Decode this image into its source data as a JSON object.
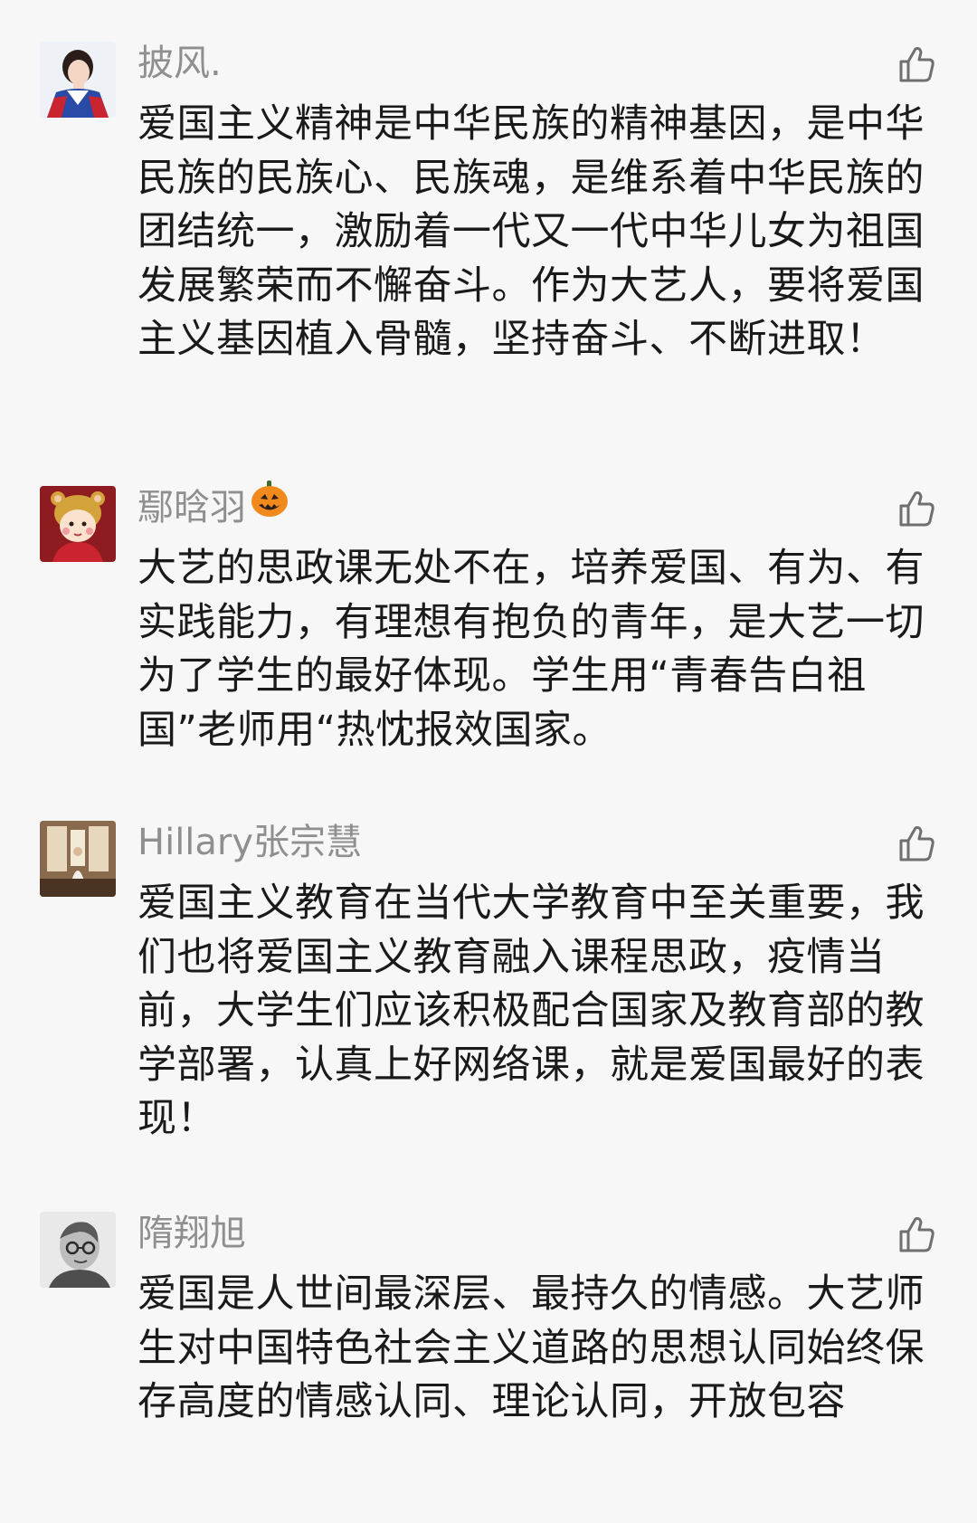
{
  "comments": [
    {
      "username": "披风.",
      "username_emoji": "",
      "avatar": "avatar-cartoon-man",
      "text": "爱国主义精神是中华民族的精神基因，是中华民族的民族心、民族魂，是维系着中华民族的团结统一，激励着一代又一代中华儿女为祖国发展繁荣而不懈奋斗。作为大艺人，要将爱国主义基因植入骨髓，坚持奋斗、不断进取！",
      "like_icon": "thumbs-up-icon"
    },
    {
      "username": "鄢晗羽",
      "username_emoji": "jack-o-lantern-icon",
      "avatar": "avatar-cartoon-girl",
      "text": "大艺的思政课无处不在，培养爱国、有为、有实践能力，有理想有抱负的青年，是大艺一切为了学生的最好体现。学生用“青春告白祖国”老师用“热忱报效国家。",
      "like_icon": "thumbs-up-icon"
    },
    {
      "username": "Hillary张宗慧",
      "username_emoji": "",
      "avatar": "avatar-photo-room",
      "text": "爱国主义教育在当代大学教育中至关重要，我们也将爱国主义教育融入课程思政，疫情当前，大学生们应该积极配合国家及教育部的教学部署，认真上好网络课，就是爱国最好的表现！",
      "like_icon": "thumbs-up-icon"
    },
    {
      "username": "隋翔旭",
      "username_emoji": "",
      "avatar": "avatar-sketch-portrait",
      "text": "爱国是人世间最深层、最持久的情感。大艺师生对中国特色社会主义道路的思想认同始终保存高度的情感认同、理论认同，开放包容",
      "like_icon": "thumbs-up-icon"
    }
  ],
  "colors": {
    "background": "#f7f7f7",
    "username": "#8f8f8f",
    "text": "#1a1a1a",
    "icon": "#6f6f6f"
  }
}
